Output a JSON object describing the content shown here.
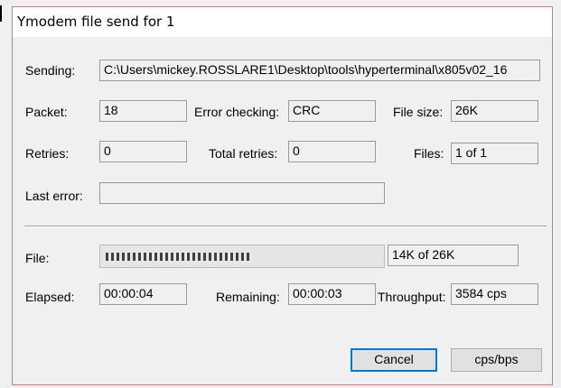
{
  "window": {
    "title": "Ymodem file send for 1"
  },
  "labels": {
    "sending": "Sending:",
    "packet": "Packet:",
    "error_checking": "Error checking:",
    "file_size": "File size:",
    "retries": "Retries:",
    "total_retries": "Total retries:",
    "files": "Files:",
    "last_error": "Last error:",
    "file": "File:",
    "elapsed": "Elapsed:",
    "remaining": "Remaining:",
    "throughput": "Throughput:"
  },
  "values": {
    "sending": "C:\\Users\\mickey.ROSSLARE1\\Desktop\\tools\\hyperterminal\\x805v02_16",
    "packet": "18",
    "error_checking": "CRC",
    "file_size": "26K",
    "retries": "0",
    "total_retries": "0",
    "files": "1 of 1",
    "last_error": "",
    "file_progress_text": "14K of 26K",
    "elapsed": "00:00:04",
    "remaining": "00:00:03",
    "throughput": "3584 cps"
  },
  "progress": {
    "fraction": 0.54
  },
  "buttons": {
    "cancel": "Cancel",
    "cps_bps": "cps/bps"
  }
}
